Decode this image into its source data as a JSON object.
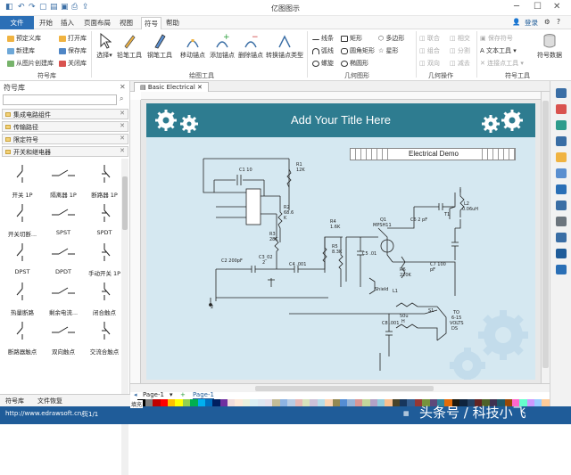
{
  "window": {
    "title": "亿图图示",
    "login": "登录"
  },
  "menu": {
    "file": "文件",
    "tabs": [
      "开始",
      "插入",
      "页面布局",
      "视图",
      "符号",
      "帮助"
    ],
    "active": "符号"
  },
  "ribbon": {
    "library": {
      "items": [
        "预定义库",
        "新建库",
        "从图片创建库",
        "打开库",
        "保存库",
        "关闭库"
      ],
      "label": "符号库"
    },
    "draw": {
      "buttons": [
        "选择",
        "铅笔工具",
        "钢笔工具",
        "移动锚点",
        "添加锚点",
        "删除锚点",
        "转换锚点类型"
      ],
      "label": "绘图工具"
    },
    "shapes": {
      "items": [
        "线条",
        "弧线",
        "螺旋",
        "矩形",
        "圆角矩形",
        "椭圆形",
        "多边形",
        "星形"
      ],
      "label": "几何图形"
    },
    "ops": {
      "items": [
        "联合",
        "组合",
        "相交",
        "分割",
        "双向",
        "减去"
      ],
      "label": "几何操作"
    },
    "symbol": {
      "items": [
        "保存符号",
        "文本工具",
        "连接点工具"
      ],
      "big": "符号数据",
      "label": "符号工具"
    }
  },
  "panel": {
    "title": "符号库",
    "libraries": [
      "集成电路组件",
      "传输路径",
      "限定符号",
      "开关和继电器"
    ],
    "symbols": [
      "开关 1P",
      "隔离器 1P",
      "断路器 1P",
      "开关切断...",
      "SPST",
      "SPDT",
      "DPST",
      "DPDT",
      "手动开关 1P",
      "热量断路",
      "剩余电流...",
      "闭合触点",
      "断路器触点",
      "双向触点",
      "交流合触点"
    ],
    "bottom_tabs": [
      "符号库",
      "文件恢复"
    ]
  },
  "doc": {
    "tab": "Basic Electrical",
    "page_title": "Add Your Title Here",
    "demo_label": "Electrical Demo"
  },
  "circuit_labels": [
    "C1 10",
    "R1",
    "12K",
    "R2",
    "68.6",
    "K",
    "R3",
    "28K",
    "C3_02",
    "2",
    "C4 .001",
    "C2 200pF",
    "R4",
    "1.6K",
    "R5",
    "8.3K",
    "C5 .01",
    "Q1",
    "MPSH11",
    "C6 2 pF",
    "R6",
    "220K",
    "Shield",
    "C7 100",
    "pF",
    "L2",
    "0.06uH",
    "T1",
    "L1",
    "50u",
    "H",
    "C8 .001",
    "S1",
    "TO",
    "6-15",
    "VOLTS",
    "DS",
    "2"
  ],
  "pagebar": {
    "page_a": "Page-1",
    "page_b": "Page-1",
    "fill": "填充"
  },
  "status": {
    "url": "http://www.edrawsoft.cn/",
    "page": "页1/1"
  },
  "watermark": "头条号 / 科技小飞"
}
